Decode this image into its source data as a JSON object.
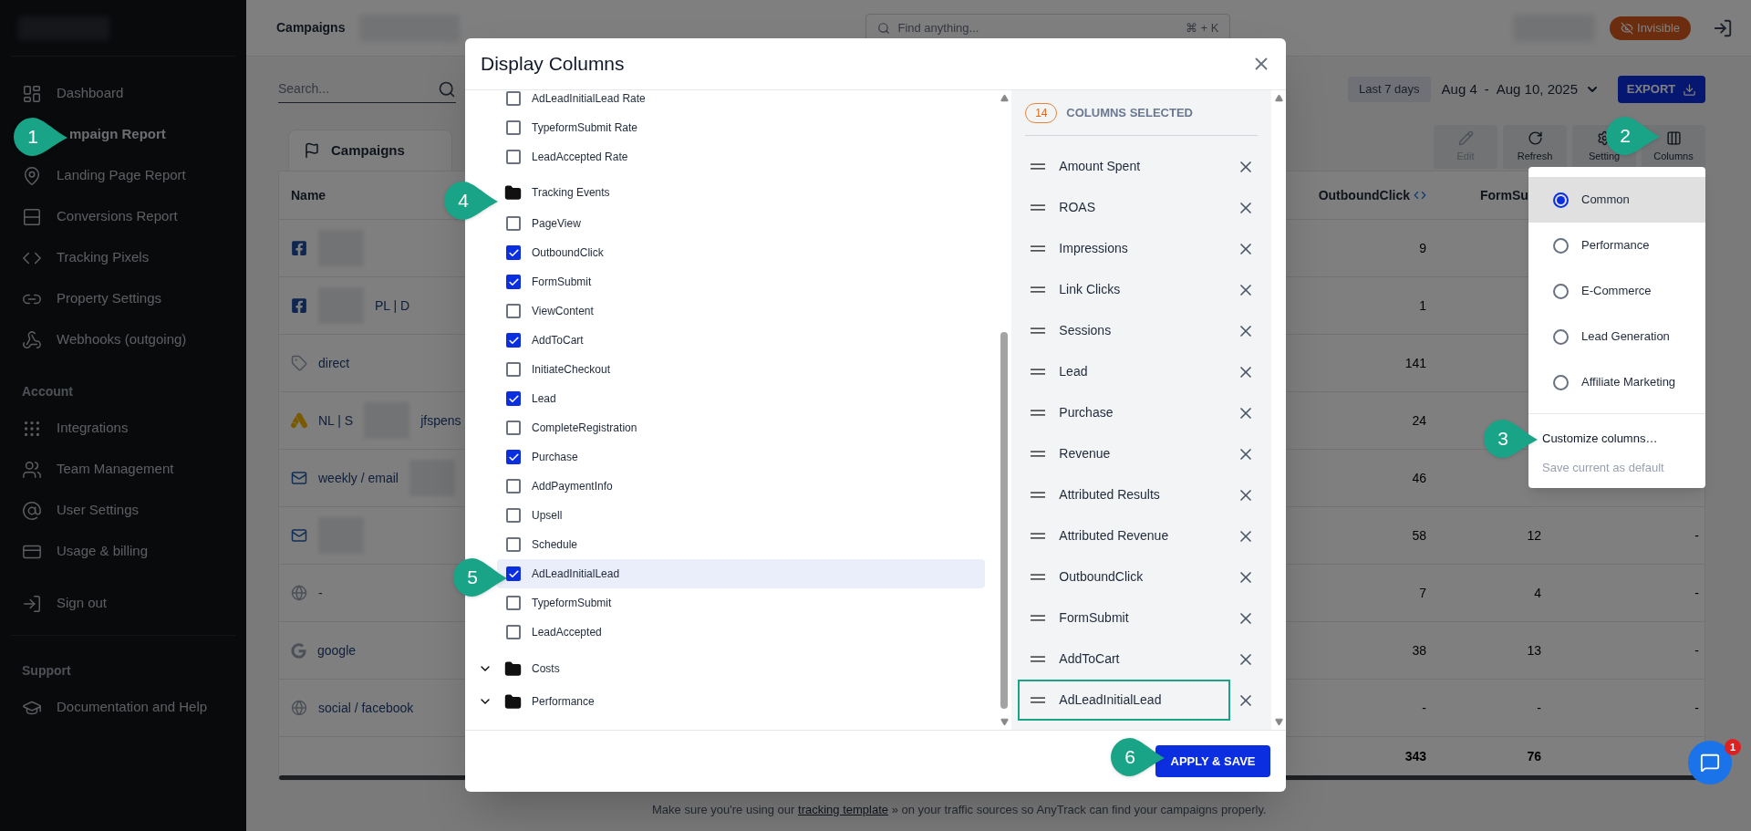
{
  "sidebar": {
    "sections": [
      {
        "items": [
          {
            "label": "Dashboard",
            "selected": false
          },
          {
            "label": "mpaign Report",
            "selected": true
          },
          {
            "label": "Landing Page Report",
            "selected": false
          },
          {
            "label": "Conversions Report",
            "selected": false
          },
          {
            "label": "Tracking Pixels",
            "selected": false
          },
          {
            "label": "Property Settings",
            "selected": false
          },
          {
            "label": "Webhooks (outgoing)",
            "selected": false
          }
        ]
      },
      {
        "title": "Account",
        "items": [
          {
            "label": "Integrations",
            "selected": false
          },
          {
            "label": "Team Management",
            "selected": false
          },
          {
            "label": "User Settings",
            "selected": false
          },
          {
            "label": "Usage & billing",
            "selected": false
          }
        ]
      },
      {
        "items": [
          {
            "label": "Sign out",
            "selected": false
          }
        ]
      },
      {
        "title": "Support",
        "items": [
          {
            "label": "Documentation and Help",
            "selected": false
          }
        ]
      }
    ]
  },
  "topbar": {
    "title": "Campaigns",
    "search_placeholder": "Find anything...",
    "shortcut": "⌘ + K",
    "status_badge": "Invisible"
  },
  "toolbar": {
    "search_placeholder": "Search...",
    "date_preset": "Last 7 days",
    "date_start": "Aug 4",
    "date_separator": "-",
    "date_end": "Aug 10, 2025",
    "export": "EXPORT",
    "tab": "Campaigns",
    "buttons": [
      {
        "label": "Edit",
        "disabled": true
      },
      {
        "label": "Refresh",
        "disabled": false
      },
      {
        "label": "Setting",
        "disabled": false
      },
      {
        "label": "Columns",
        "disabled": false
      }
    ]
  },
  "table": {
    "columns": [
      "Name",
      "OutboundClick",
      "FormSu"
    ],
    "rows": [
      {
        "kind": "facebook",
        "blurred": true,
        "outbound": "9"
      },
      {
        "kind": "facebook",
        "blurred": true,
        "name_tail": "PL | D",
        "outbound": "1"
      },
      {
        "kind": "direct",
        "blurred": false,
        "name": "direct",
        "outbound": "141"
      },
      {
        "kind": "ads",
        "blurred": true,
        "name": "NL | S",
        "name_tail": "jfspens",
        "outbound": "24"
      },
      {
        "kind": "email",
        "blurred": true,
        "name": "weekly / email",
        "outbound": "46"
      },
      {
        "kind": "email",
        "blurred": true,
        "outbound": "58",
        "form": "12",
        "column_3": "-"
      },
      {
        "kind": "web",
        "blurred": false,
        "name": "-",
        "outbound": "7",
        "form": "4",
        "column_3": "-"
      },
      {
        "kind": "search",
        "blurred": false,
        "name": "google",
        "outbound": "38",
        "form": "13",
        "column_3": "-"
      },
      {
        "kind": "web",
        "blurred": false,
        "name": "social / facebook",
        "outbound": "-",
        "form": "-",
        "column_3": "-"
      }
    ],
    "totals": {
      "outbound": "343",
      "form": "76"
    }
  },
  "help": {
    "before": "Make sure you're using our",
    "link": "tracking template",
    "after": "» on your traffic sources so AnyTrack can find your campaigns properly."
  },
  "dialog": {
    "title": "Display Columns",
    "items": [
      {
        "kind": "check",
        "label": "AdLeadInitialLead Rate",
        "checked": false,
        "highlighted": false
      },
      {
        "kind": "check",
        "label": "TypeformSubmit Rate",
        "checked": false,
        "highlighted": false
      },
      {
        "kind": "check",
        "label": "LeadAccepted Rate",
        "checked": false,
        "highlighted": false
      },
      {
        "kind": "folder",
        "label": "Tracking Events",
        "expanded": true,
        "children": [
          {
            "kind": "check",
            "label": "PageView",
            "checked": false,
            "highlighted": false
          },
          {
            "kind": "check",
            "label": "OutboundClick",
            "checked": true,
            "highlighted": false
          },
          {
            "kind": "check",
            "label": "FormSubmit",
            "checked": true,
            "highlighted": false
          },
          {
            "kind": "check",
            "label": "ViewContent",
            "checked": false,
            "highlighted": false
          },
          {
            "kind": "check",
            "label": "AddToCart",
            "checked": true,
            "highlighted": false
          },
          {
            "kind": "check",
            "label": "InitiateCheckout",
            "checked": false,
            "highlighted": false
          },
          {
            "kind": "check",
            "label": "Lead",
            "checked": true,
            "highlighted": false
          },
          {
            "kind": "check",
            "label": "CompleteRegistration",
            "checked": false,
            "highlighted": false
          },
          {
            "kind": "check",
            "label": "Purchase",
            "checked": true,
            "highlighted": false
          },
          {
            "kind": "check",
            "label": "AddPaymentInfo",
            "checked": false,
            "highlighted": false
          },
          {
            "kind": "check",
            "label": "Upsell",
            "checked": false,
            "highlighted": false
          },
          {
            "kind": "check",
            "label": "Schedule",
            "checked": false,
            "highlighted": false
          },
          {
            "kind": "check",
            "label": "AdLeadInitialLead",
            "checked": true,
            "highlighted": true
          },
          {
            "kind": "check",
            "label": "TypeformSubmit",
            "checked": false,
            "highlighted": false
          },
          {
            "kind": "check",
            "label": "LeadAccepted",
            "checked": false,
            "highlighted": false
          }
        ]
      },
      {
        "kind": "folder",
        "label": "Costs",
        "expanded": false
      },
      {
        "kind": "folder",
        "label": "Performance",
        "expanded": false
      }
    ],
    "selected_count": "14",
    "selected_label": "COLUMNS SELECTED",
    "selected_columns": [
      {
        "label": "Amount Spent",
        "highlighted": false
      },
      {
        "label": "ROAS",
        "highlighted": false
      },
      {
        "label": "Impressions",
        "highlighted": false
      },
      {
        "label": "Link Clicks",
        "highlighted": false
      },
      {
        "label": "Sessions",
        "highlighted": false
      },
      {
        "label": "Lead",
        "highlighted": false
      },
      {
        "label": "Purchase",
        "highlighted": false
      },
      {
        "label": "Revenue",
        "highlighted": false
      },
      {
        "label": "Attributed Results",
        "highlighted": false
      },
      {
        "label": "Attributed Revenue",
        "highlighted": false
      },
      {
        "label": "OutboundClick",
        "highlighted": false
      },
      {
        "label": "FormSubmit",
        "highlighted": false
      },
      {
        "label": "AddToCart",
        "highlighted": false
      },
      {
        "label": "AdLeadInitialLead",
        "highlighted": true
      }
    ],
    "apply": "APPLY & SAVE"
  },
  "columns_menu": {
    "options": [
      {
        "label": "Common",
        "selected": true
      },
      {
        "label": "Performance",
        "selected": false
      },
      {
        "label": "E-Commerce",
        "selected": false
      },
      {
        "label": "Lead Generation",
        "selected": false
      },
      {
        "label": "Affiliate Marketing",
        "selected": false
      }
    ],
    "actions": [
      {
        "label": "Customize columns…",
        "disabled": false
      },
      {
        "label": "Save current as default",
        "disabled": true
      }
    ]
  },
  "chat": {
    "badge": "1"
  },
  "callouts": [
    "1",
    "2",
    "3",
    "4",
    "5",
    "6"
  ]
}
